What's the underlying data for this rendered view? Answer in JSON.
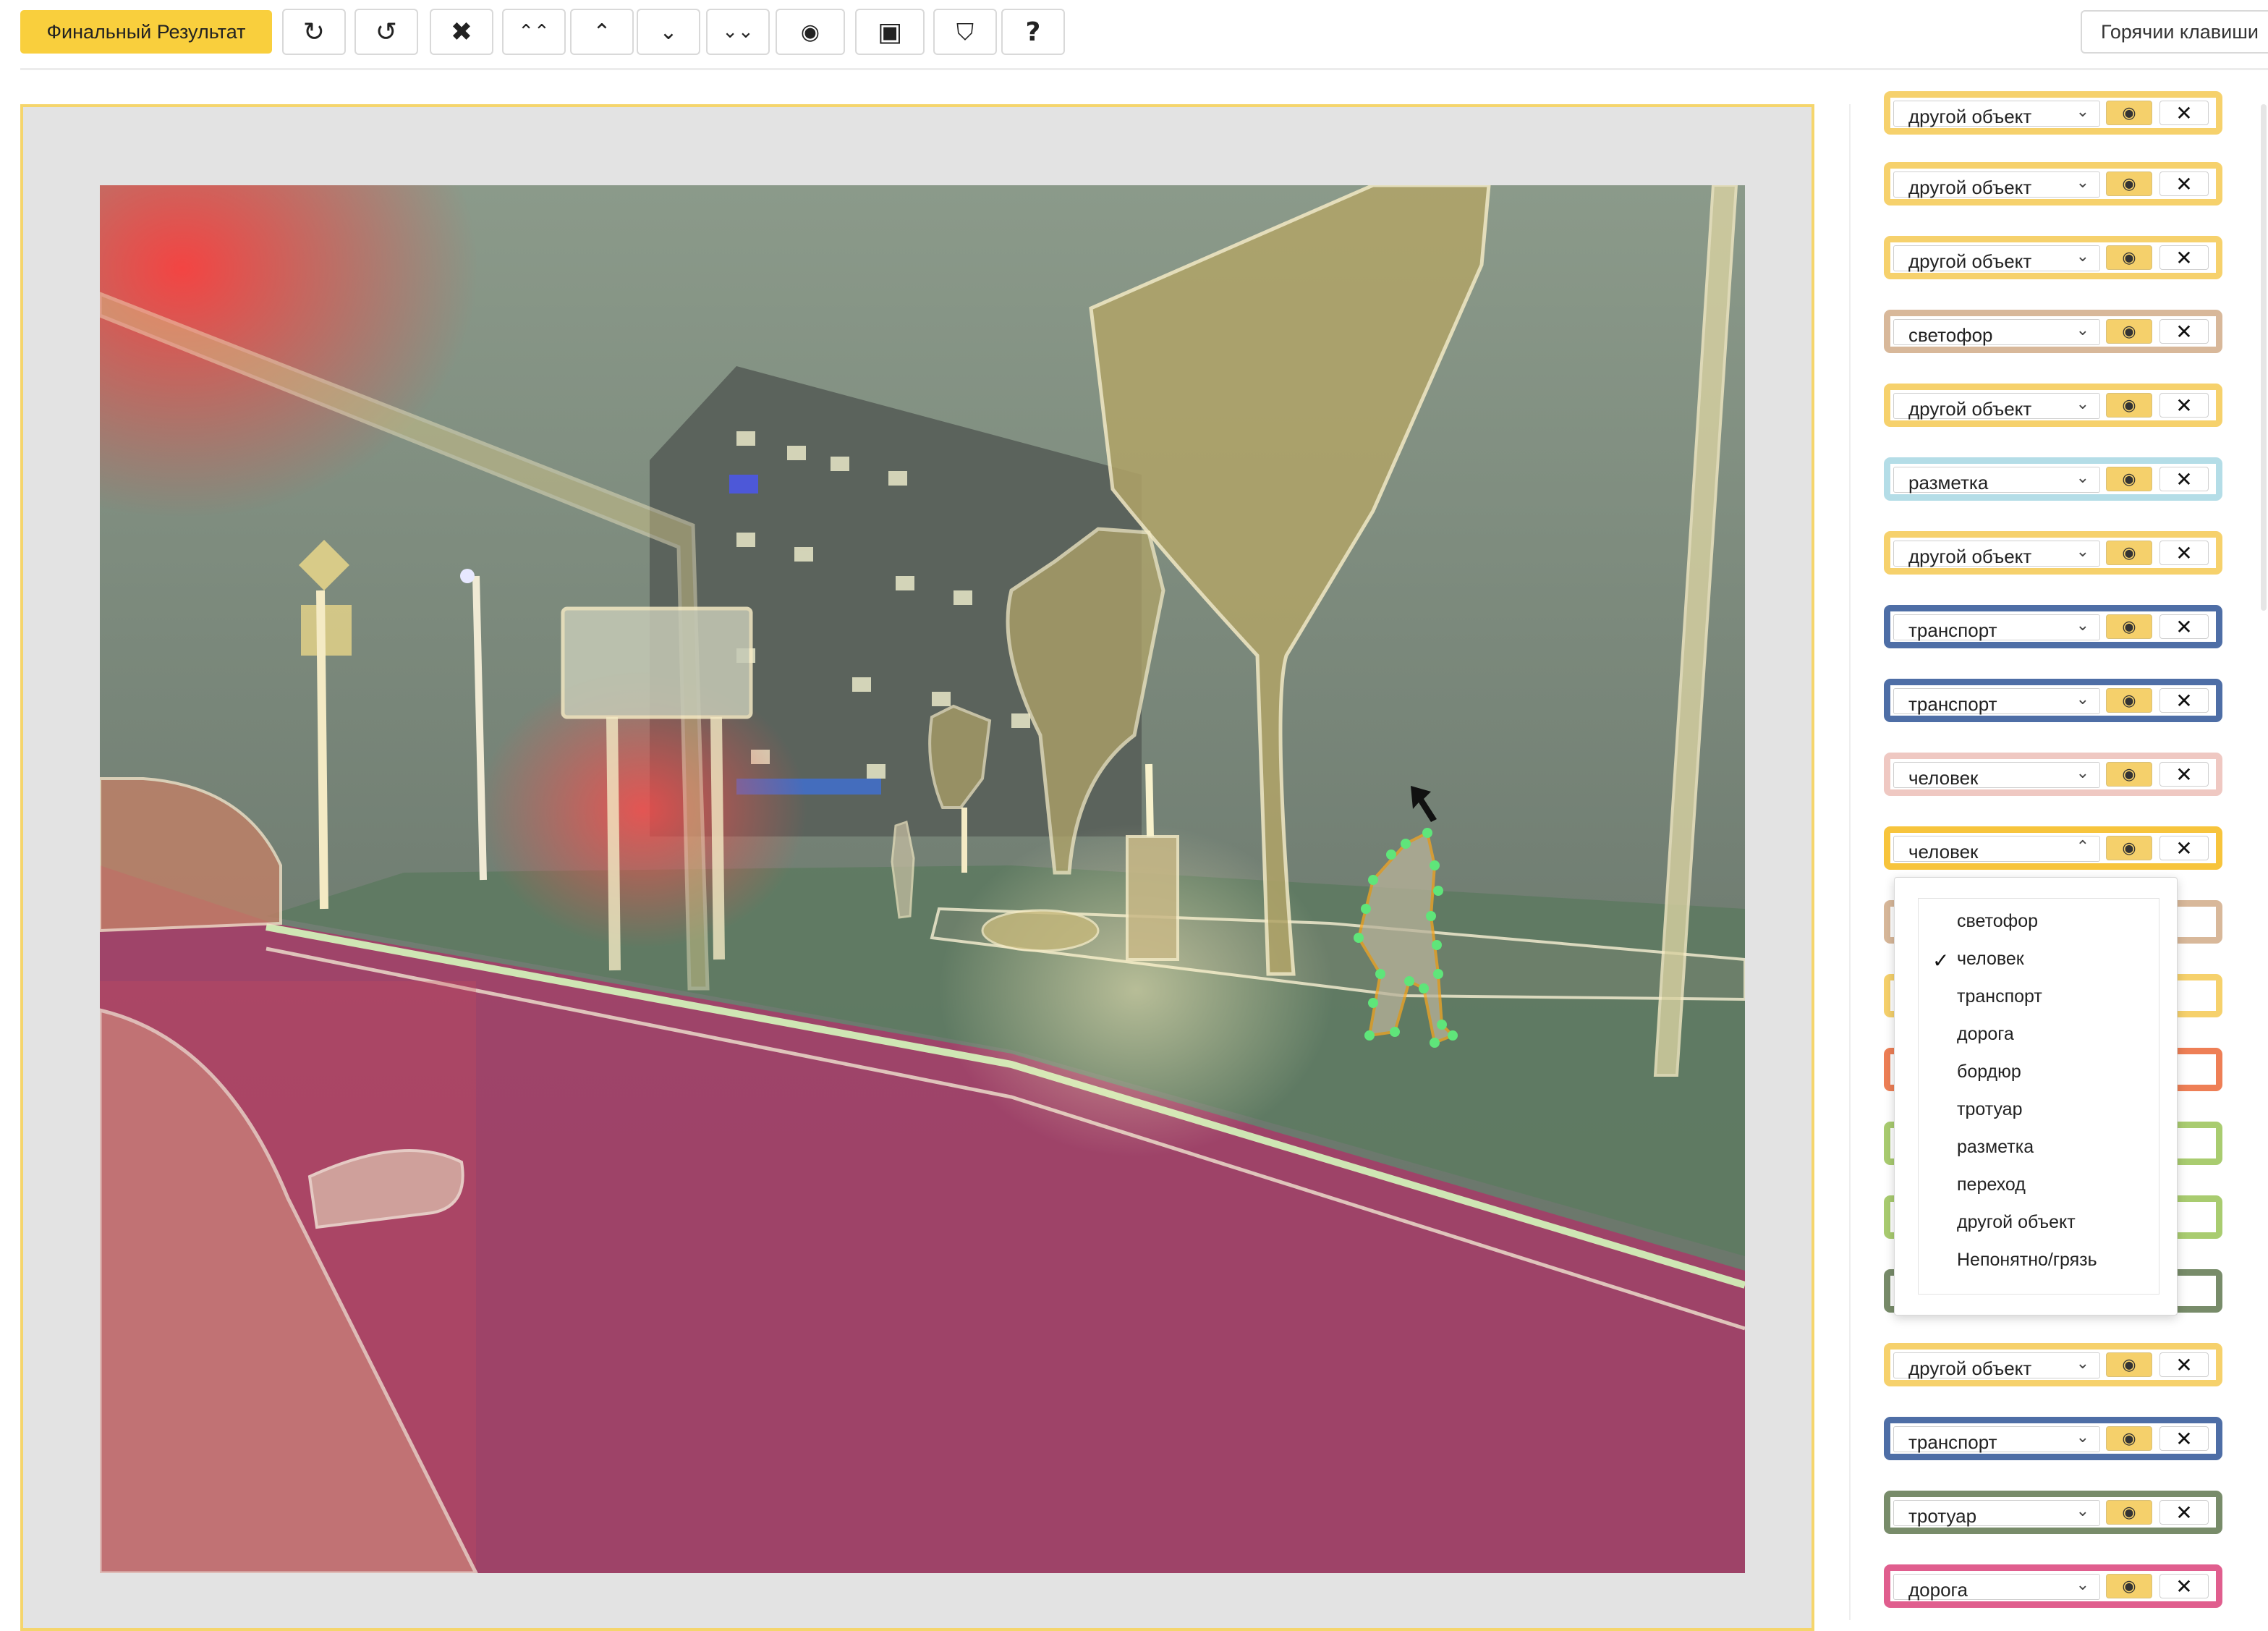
{
  "toolbar": {
    "final_result_label": "Финальный Результат",
    "tools": [
      {
        "name": "redo-icon",
        "glyph": "↻"
      },
      {
        "name": "undo-icon",
        "glyph": "↺"
      },
      {
        "name": "close-icon",
        "glyph": "✖"
      },
      {
        "name": "double-chevron-up-icon",
        "glyph": "⌃⌃"
      },
      {
        "name": "chevron-up-icon",
        "glyph": "⌃"
      },
      {
        "name": "chevron-down-icon",
        "glyph": "⌄"
      },
      {
        "name": "double-chevron-down-icon",
        "glyph": "⌄⌄"
      },
      {
        "name": "eye-off-icon",
        "glyph": "◉"
      },
      {
        "name": "image-icon",
        "glyph": "▣"
      },
      {
        "name": "shield-icon",
        "glyph": "⛉"
      },
      {
        "name": "help-icon",
        "glyph": "?"
      }
    ],
    "hotkeys_label": "Горячии клавиши"
  },
  "icons": {
    "eye": "eye-icon",
    "delete": "close-icon",
    "chevron": "chevron-down-icon"
  },
  "objects": [
    {
      "label": "другой объект",
      "color": "#f6d16c"
    },
    {
      "label": "другой объект",
      "color": "#f6d16c"
    },
    {
      "label": "другой объект",
      "color": "#f6d16c"
    },
    {
      "label": "светофор",
      "color": "#d8b89a"
    },
    {
      "label": "другой объект",
      "color": "#f6d16c"
    },
    {
      "label": "разметка",
      "color": "#b4dde7"
    },
    {
      "label": "другой объект",
      "color": "#f6d16c"
    },
    {
      "label": "транспорт",
      "color": "#4e6ea6"
    },
    {
      "label": "транспорт",
      "color": "#4e6ea6"
    },
    {
      "label": "человек",
      "color": "#efc8c2"
    },
    {
      "label": "человек",
      "color": "#f7c43c"
    },
    {
      "label": "другой объект",
      "color": "#f6d16c"
    },
    {
      "label": "транспорт",
      "color": "#4e6ea6"
    },
    {
      "label": "тротуар",
      "color": "#788c6a"
    },
    {
      "label": "дорога",
      "color": "#e05e8e"
    }
  ],
  "dropdown": {
    "selected": "человек",
    "options": [
      "светофор",
      "человек",
      "транспорт",
      "дорога",
      "бордюр",
      "тротуар",
      "разметка",
      "переход",
      "другой объект",
      "Непонятно/грязь"
    ]
  },
  "colors": {
    "accent": "#f9cf3d",
    "road": "#a33f68",
    "sidewalk": "#5f7a62",
    "person_points": "#5fe57a"
  }
}
